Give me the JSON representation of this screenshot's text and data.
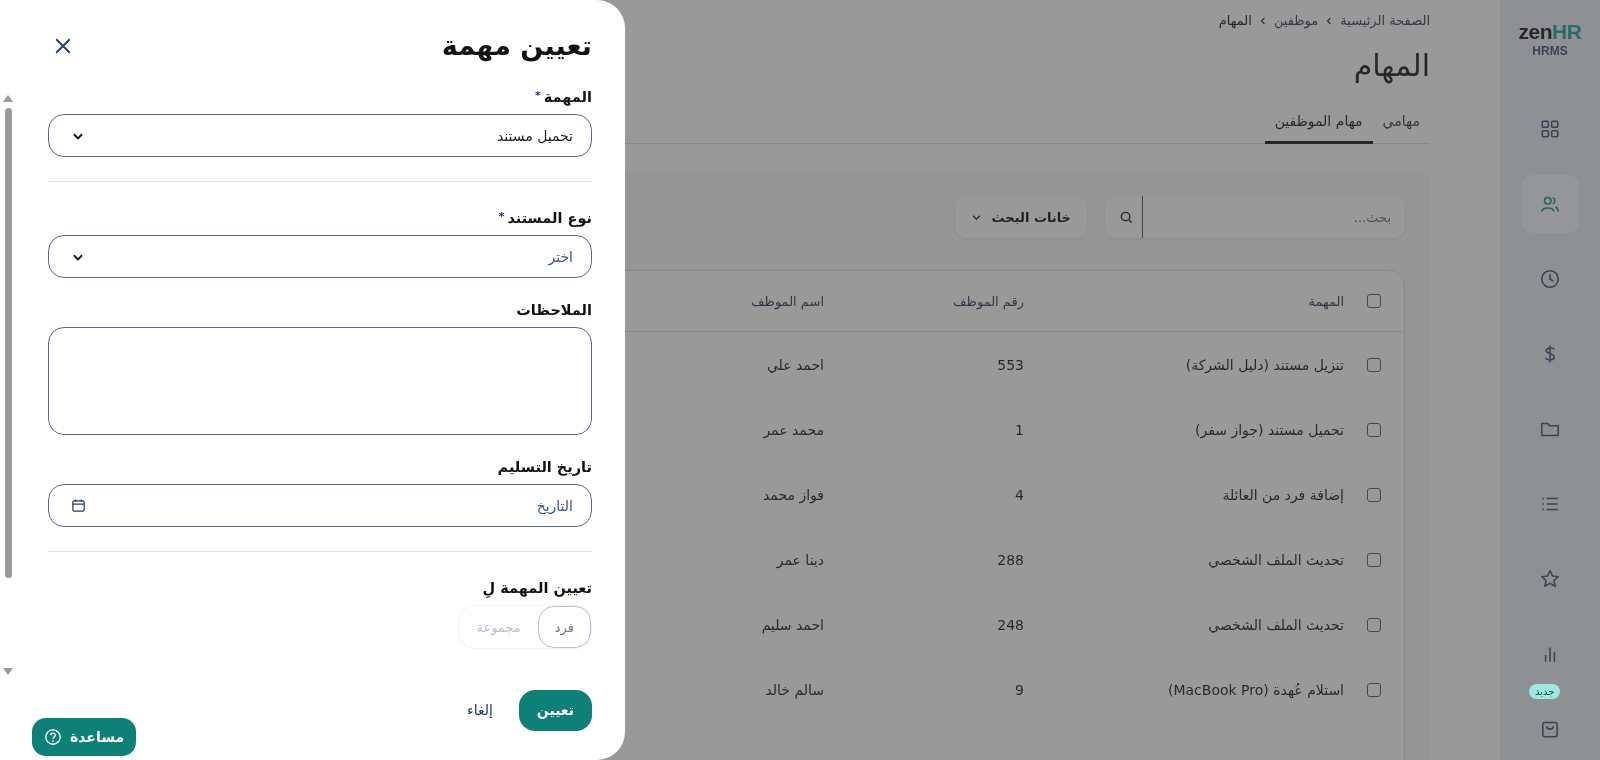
{
  "sidebar": {
    "logo": {
      "part_1": "zen",
      "part_2": "HR",
      "subtitle": "HRMS"
    },
    "items": [
      {
        "kind": "grid",
        "selected": false
      },
      {
        "kind": "users",
        "selected": true
      },
      {
        "kind": "clock",
        "selected": false
      },
      {
        "kind": "dollar",
        "selected": false
      },
      {
        "kind": "folder",
        "selected": false
      },
      {
        "kind": "list",
        "selected": false
      },
      {
        "kind": "star",
        "selected": false
      },
      {
        "kind": "chart",
        "selected": false
      },
      {
        "kind": "bag",
        "selected": false,
        "badge": "جديد"
      }
    ]
  },
  "breadcrumb": [
    "الصفحة الرئيسية",
    "موظفين",
    "المهام"
  ],
  "title": "المهام",
  "tabs": [
    {
      "label": "مهامي",
      "selected": false
    },
    {
      "label": "مهام الموظفين",
      "selected": true
    }
  ],
  "search": {
    "placeholder": "بحث..."
  },
  "filter_button": "خانات البحث",
  "table": {
    "header_checked": false,
    "columns": [
      "المهمة",
      "رقم الموظف",
      "اسم الموظف"
    ],
    "rows": [
      {
        "checked": false,
        "cells": [
          "تنزيل مستند (دليل الشركة)",
          "553",
          "احمد علي"
        ]
      },
      {
        "checked": false,
        "cells": [
          "تحميل مستند (جواز سفر)",
          "1",
          "محمد عمر"
        ]
      },
      {
        "checked": false,
        "cells": [
          "إضافة فرد من العائلة",
          "4",
          "فواز محمد"
        ]
      },
      {
        "checked": false,
        "cells": [
          "تحديث الملف الشخصي",
          "288",
          "دينا عمر"
        ]
      },
      {
        "checked": false,
        "cells": [
          "تحديث الملف الشخصي",
          "248",
          "احمد سليم"
        ]
      },
      {
        "checked": false,
        "cells": [
          "استلام عُهدة (MacBook Pro)",
          "9",
          "سالم خالد"
        ]
      }
    ]
  },
  "drawer": {
    "title": "تعيين مهمة",
    "sections": [
      [
        {
          "kind": "select",
          "label": "المهمة",
          "required_mark": "*",
          "value": "تحميل مستند"
        }
      ],
      [
        {
          "kind": "select",
          "label": "نوع المستند",
          "required_mark": "*",
          "placeholder": "اختر"
        },
        {
          "kind": "textarea",
          "label": "الملاحظات"
        },
        {
          "kind": "date",
          "label": "تاريخ التسليم",
          "placeholder": "التاريخ"
        }
      ],
      [
        {
          "kind": "toggle",
          "label": "تعيين المهمة لِ",
          "options": [
            {
              "label": "فرد",
              "selected": true
            },
            {
              "label": "مجموعة",
              "selected": false
            }
          ]
        }
      ]
    ],
    "submit": "تعيين",
    "cancel": "إلغاء"
  },
  "help_button": "مساعدة"
}
